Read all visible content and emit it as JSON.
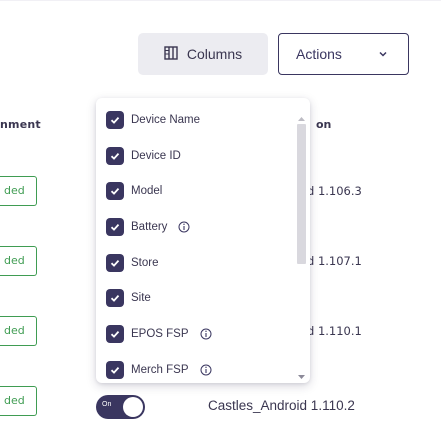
{
  "table": {
    "col_partial_left": "nment",
    "col_partial_right": "on",
    "rows": [
      {
        "status": "ded",
        "version": ""
      },
      {
        "status": "ded",
        "version": "d 1.106.3"
      },
      {
        "status": "ded",
        "version": "d 1.107.1"
      },
      {
        "status": "ded",
        "version": "d 1.110.1"
      },
      {
        "status": "ded",
        "version": ""
      }
    ],
    "status_color": "#3f9c52"
  },
  "toolbar": {
    "columns_label": "Columns",
    "columns_icon": "columns-icon",
    "actions_label": "Actions",
    "actions_icon": "chevron-down-icon"
  },
  "columns_menu": {
    "items": [
      {
        "label": "Device Name",
        "checked": true,
        "info": false
      },
      {
        "label": "Device ID",
        "checked": true,
        "info": false
      },
      {
        "label": "Model",
        "checked": true,
        "info": false
      },
      {
        "label": "Battery",
        "checked": true,
        "info": true
      },
      {
        "label": "Store",
        "checked": true,
        "info": false
      },
      {
        "label": "Site",
        "checked": true,
        "info": false
      },
      {
        "label": "EPOS FSP",
        "checked": true,
        "info": true
      },
      {
        "label": "Merch FSP",
        "checked": true,
        "info": true
      }
    ]
  },
  "bottom_row": {
    "toggle_text": "On",
    "toggle_state": "on",
    "app_version": "Castles_Android 1.110.2"
  },
  "colors": {
    "accent": "#3a3660",
    "button_bg": "#ececf1"
  }
}
